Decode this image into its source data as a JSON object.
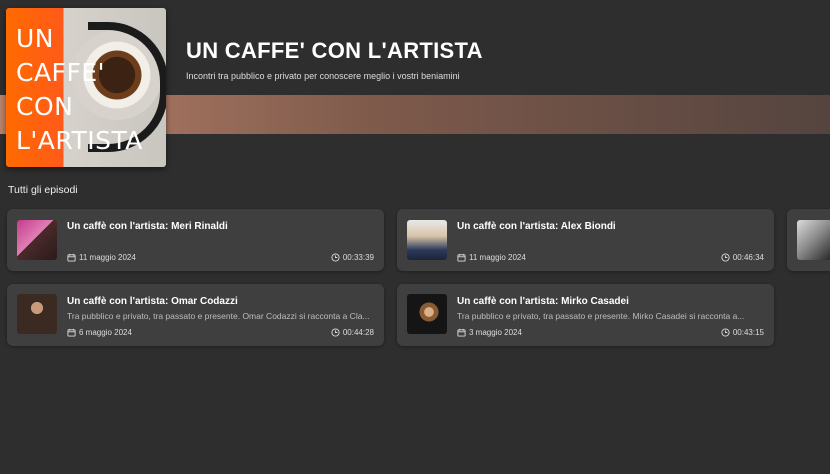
{
  "podcast": {
    "cover_text": "UN\nCAFFE'\nCON\nL'ARTISTA",
    "title": "UN CAFFE' CON L'ARTISTA",
    "subtitle": "Incontri tra pubblico e privato per conoscere meglio i vostri beniamini"
  },
  "section": {
    "label": "Tutti gli episodi"
  },
  "episodes": [
    {
      "title": "Un caffè con l'artista: Meri Rinaldi",
      "description": "",
      "date": "11 maggio 2024",
      "duration": "00:33:39"
    },
    {
      "title": "Un caffè con l'artista: Alex Biondi",
      "description": "",
      "date": "11 maggio 2024",
      "duration": "00:46:34"
    },
    {
      "title": "Un caffè con l'artista: Omar Codazzi",
      "description": "Tra pubblico e privato, tra passato e presente. Omar Codazzi si racconta a Cla...",
      "date": "6 maggio 2024",
      "duration": "00:44:28"
    },
    {
      "title": "Un caffè con l'artista: Mirko Casadei",
      "description": "Tra pubblico e privato, tra passato e presente. Mirko Casadei si racconta a...",
      "date": "3 maggio 2024",
      "duration": "00:43:15"
    }
  ],
  "icons": {
    "date": "calendar-icon",
    "duration": "clock-icon"
  }
}
